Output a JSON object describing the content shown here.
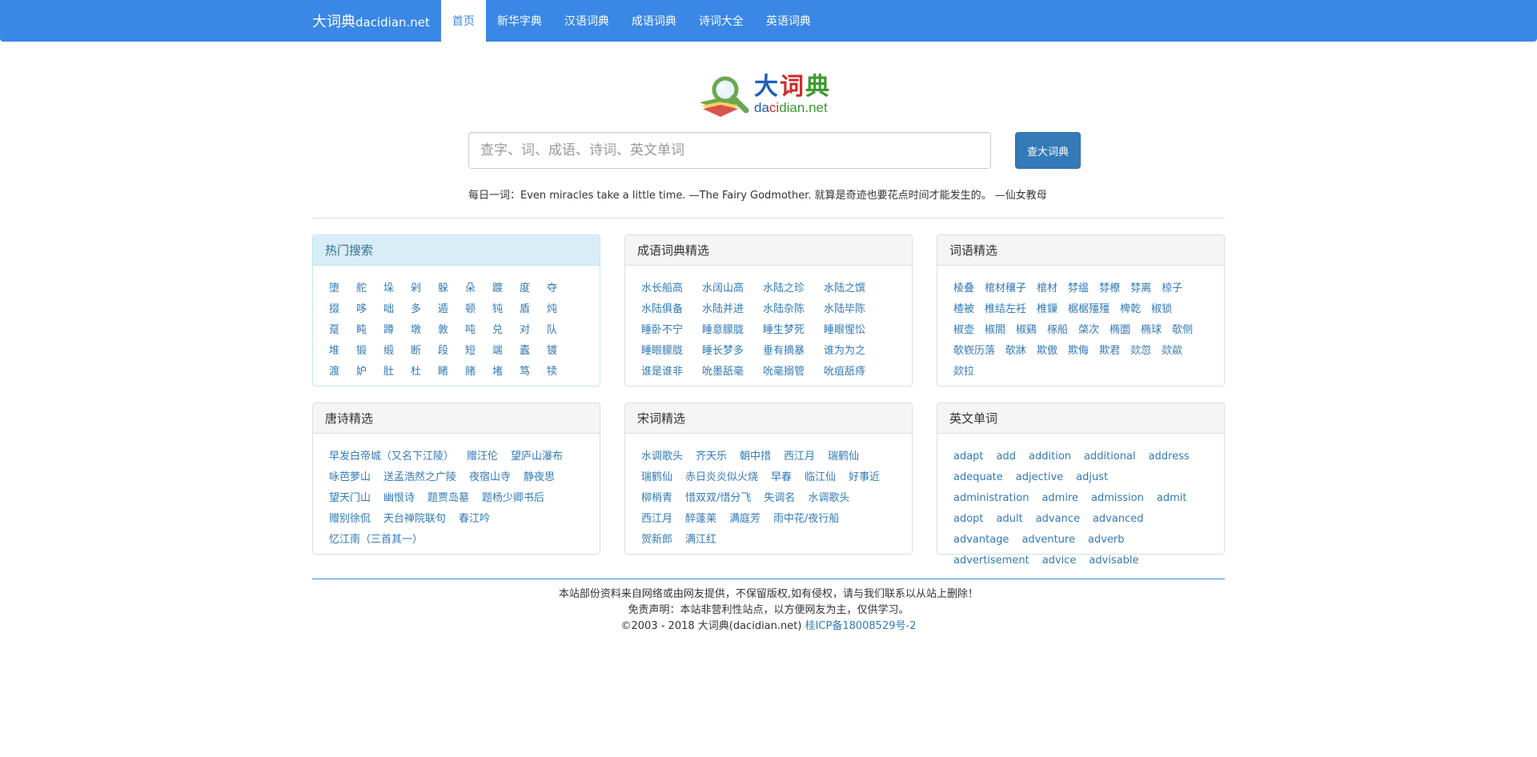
{
  "navbar": {
    "brand_cn": "大词典",
    "brand_en": "dacidian.net",
    "items": [
      "首页",
      "新华字典",
      "汉语词典",
      "成语词典",
      "诗词大全",
      "英语词典"
    ]
  },
  "logo": {
    "cn1": "大",
    "cn2": "词",
    "cn3": "典",
    "en_a": "da",
    "en_b": "ci",
    "en_c": "dian.net"
  },
  "search": {
    "placeholder": "查字、词、成语、诗词、英文单词",
    "button": "查大词典"
  },
  "daily": "每日一词：Even miracles take a little time. —The Fairy Godmother. 就算是奇迹也要花点时间才能发生的。 —仙女教母",
  "panels": {
    "hot": {
      "title": "热门搜索",
      "items": [
        "堕",
        "舵",
        "垛",
        "剁",
        "躲",
        "朵",
        "踱",
        "度",
        "夺",
        "掇",
        "哆",
        "咄",
        "多",
        "遁",
        "顿",
        "钝",
        "盾",
        "炖",
        "趸",
        "盹",
        "蹲",
        "墩",
        "敦",
        "吨",
        "兑",
        "对",
        "队",
        "堆",
        "锻",
        "缎",
        "断",
        "段",
        "短",
        "端",
        "蠹",
        "镀",
        "渡",
        "妒",
        "肚",
        "杜",
        "睹",
        "赌",
        "堵",
        "笃",
        "犊"
      ]
    },
    "idiom": {
      "title": "成语词典精选",
      "items": [
        "水长船高",
        "水阔山高",
        "水陆之珍",
        "水陆之馔",
        "水陆俱备",
        "水陆并进",
        "水陆杂陈",
        "水陆毕陈",
        "睡卧不宁",
        "睡意朦胧",
        "睡生梦死",
        "睡眼惺忪",
        "睡眼朦胧",
        "睡长梦多",
        "垂有摘暴",
        "谁为为之",
        "谁是谁非",
        "吮墨舐毫",
        "吮毫搦管",
        "吮疽舐痔"
      ]
    },
    "words": {
      "title": "词语精选",
      "items": [
        "棱叠",
        "棺材穰子",
        "棺材",
        "棼缊",
        "棼橑",
        "棼离",
        "椋子",
        "楂被",
        "椎结左衽",
        "椎鏁",
        "椐椐殭殭",
        "椑乾",
        "椒锁",
        "椒壶",
        "椒閤",
        "椒鷄",
        "椓船",
        "棨次",
        "椭圜",
        "椭球",
        "欹侧",
        "欹嵚历落",
        "欹牀",
        "欺傲",
        "欺侮",
        "欺君",
        "欻忽",
        "欻歘",
        "欻拉"
      ]
    },
    "tang": {
      "title": "唐诗精选",
      "items": [
        "早发白帝城（又名下江陵）",
        "赠汪伦",
        "望庐山瀑布",
        "咏芭萝山",
        "送孟浩然之广陵",
        "夜宿山寺",
        "静夜思",
        "望天门山",
        "幽恨诗",
        "题贾岛墓",
        "题杨少卿书后",
        "赠别徐侃",
        "天台禅院联句",
        "春江吟",
        "忆江南（三首其一）"
      ]
    },
    "song": {
      "title": "宋词精选",
      "items": [
        "水调歌头",
        "齐天乐",
        "朝中措",
        "西江月",
        "瑞鹤仙",
        "瑞鹤仙",
        "赤日炎炎似火烧",
        "早春",
        "临江仙",
        "好事近",
        "柳梢青",
        "惜双双/惜分飞",
        "失调名",
        "水调歌头",
        "西江月",
        "醉蓬莱",
        "满庭芳",
        "雨中花/夜行船",
        "贺新郎",
        "满江红"
      ]
    },
    "english": {
      "title": "英文单词",
      "items": [
        "adapt",
        "add",
        "addition",
        "additional",
        "address",
        "adequate",
        "adjective",
        "adjust",
        "administration",
        "admire",
        "admission",
        "admit",
        "adopt",
        "adult",
        "advance",
        "advanced",
        "advantage",
        "adventure",
        "adverb",
        "advertisement",
        "advice",
        "advisable"
      ]
    }
  },
  "footer": {
    "line1": "本站部份资料来自网络或由网友提供，不保留版权,如有侵权，请与我们联系以从站上删除！",
    "line2": "免责声明：本站非营利性站点，以方便网友为主，仅供学习。",
    "line3": "©2003 - 2018 大词典(dacidian.net)",
    "icp": "桂ICP备18008529号-2"
  }
}
